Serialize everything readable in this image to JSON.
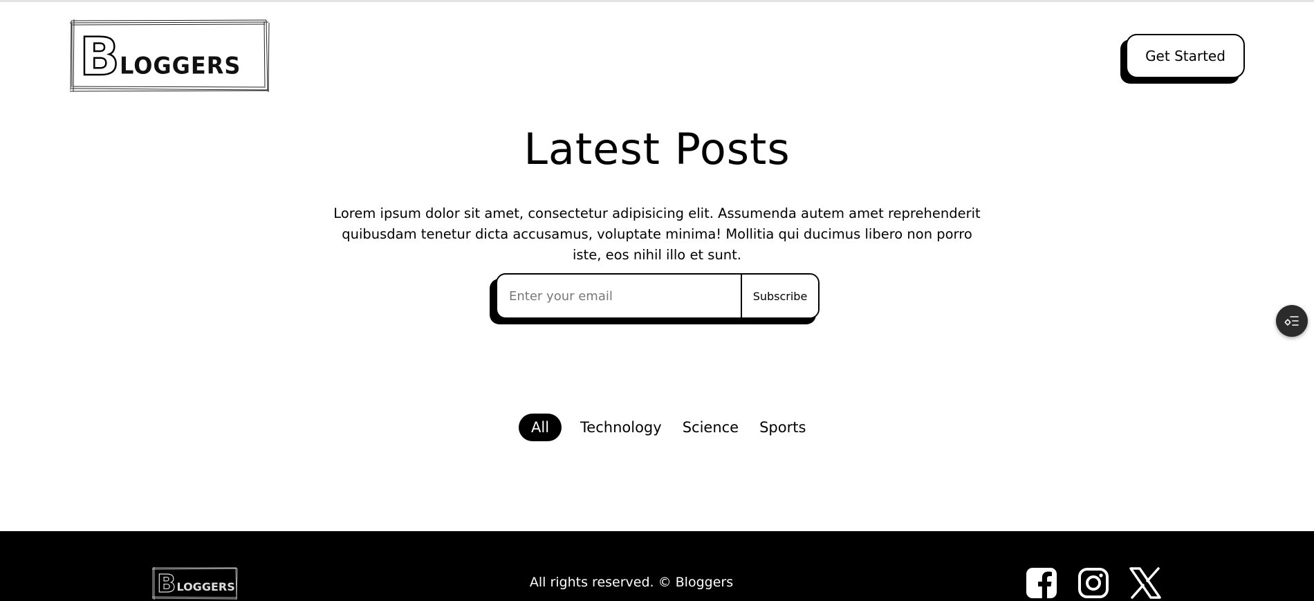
{
  "header": {
    "logo_text_initial": "B",
    "logo_text_rest": "LOGGERS",
    "cta_label": "Get Started"
  },
  "hero": {
    "title": "Latest Posts",
    "description": "Lorem ipsum dolor sit amet, consectetur adipisicing elit. Assumenda autem amet reprehenderit quibusdam tenetur dicta accusamus, voluptate minima! Mollitia qui ducimus libero non porro iste, eos nihil illo et sunt."
  },
  "subscribe": {
    "email_placeholder": "Enter your email",
    "email_value": "",
    "button_label": "Subscribe"
  },
  "filters": {
    "tabs": [
      {
        "label": "All",
        "active": true
      },
      {
        "label": "Technology",
        "active": false
      },
      {
        "label": "Science",
        "active": false
      },
      {
        "label": "Sports",
        "active": false
      }
    ]
  },
  "floating_button": {
    "icon": "settings-list-icon"
  },
  "footer": {
    "logo_text_initial": "B",
    "logo_text_rest": "LOGGERS",
    "copyright": "All rights reserved. © Bloggers",
    "social_icons": [
      "facebook-icon",
      "instagram-icon",
      "x-icon"
    ]
  },
  "colors": {
    "background": "#ffffff",
    "foreground": "#000000",
    "footer_background": "#000000",
    "footer_text": "#ffffff",
    "floating_button": "#2b2b2b"
  }
}
